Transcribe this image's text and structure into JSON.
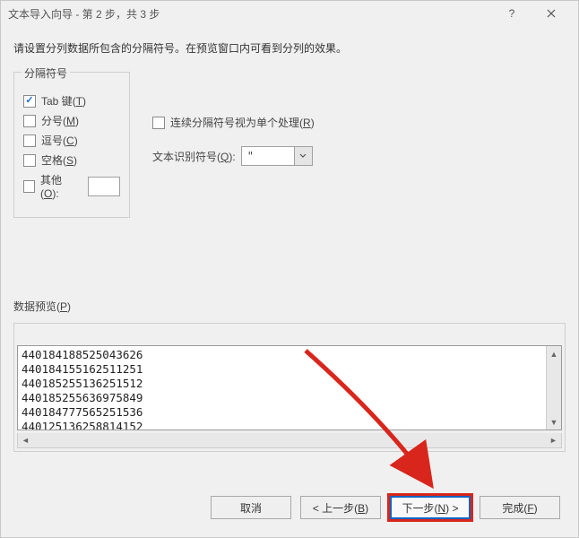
{
  "window": {
    "title": "文本导入向导 - 第 2 步，共 3 步"
  },
  "instruction": "请设置分列数据所包含的分隔符号。在预览窗口内可看到分列的效果。",
  "delim_group": {
    "legend": "分隔符号",
    "tab": {
      "label": "Tab 键",
      "accel": "T",
      "checked": true
    },
    "semi": {
      "label": "分号",
      "accel": "M",
      "checked": false
    },
    "comma": {
      "label": "逗号",
      "accel": "C",
      "checked": false
    },
    "space": {
      "label": "空格",
      "accel": "S",
      "checked": false
    },
    "other": {
      "label": "其他",
      "accel": "O",
      "checked": false,
      "value": ""
    }
  },
  "consecutive": {
    "label": "连续分隔符号视为单个处理",
    "accel": "R",
    "checked": false
  },
  "qualifier": {
    "label": "文本识别符号",
    "accel": "Q",
    "value": "\""
  },
  "preview": {
    "label": "数据预览",
    "accel": "P",
    "lines": [
      "440184188525043626",
      "440184155162511251",
      "440185255136251512",
      "440185255636975849",
      "440184777565251536",
      "440125136258814152"
    ]
  },
  "buttons": {
    "cancel": "取消",
    "back": "< 上一步(B)",
    "next": "下一步(N) >",
    "finish": "完成(F)"
  }
}
